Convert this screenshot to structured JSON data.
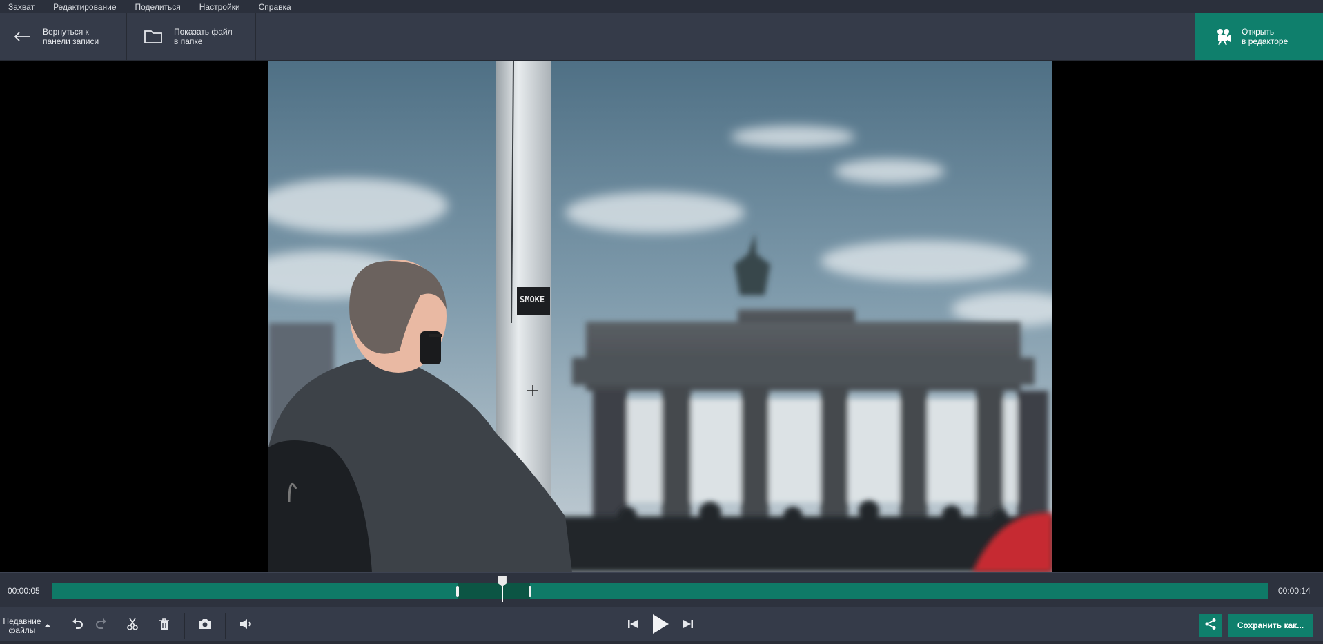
{
  "menu": [
    "Захват",
    "Редактирование",
    "Поделиться",
    "Настройки",
    "Справка"
  ],
  "toolbar": {
    "back_line1": "Вернуться к",
    "back_line2": "панели записи",
    "folder_line1": "Показать файл",
    "folder_line2": "в папке",
    "editor_line1": "Открыть",
    "editor_line2": "в редакторе"
  },
  "photo_sticker": "SMOKE",
  "timeline": {
    "current_time": "00:00:05",
    "total_time": "00:00:14",
    "playhead_fraction": 0.37,
    "selection_start_fraction": 0.333,
    "selection_end_fraction": 0.393
  },
  "controls": {
    "recent_line1": "Недавние",
    "recent_line2": "файлы",
    "save_label": "Сохранить как..."
  },
  "colors": {
    "accent": "#0f7f6c",
    "panel": "#353b49",
    "menubar": "#2b303c"
  },
  "icons": [
    "arrow-left-icon",
    "folder-icon",
    "film-camera-icon",
    "undo-icon",
    "redo-icon",
    "scissors-icon",
    "trash-icon",
    "camera-icon",
    "volume-icon",
    "skip-back-icon",
    "play-icon",
    "skip-forward-icon",
    "share-icon",
    "chevron-up-icon"
  ]
}
